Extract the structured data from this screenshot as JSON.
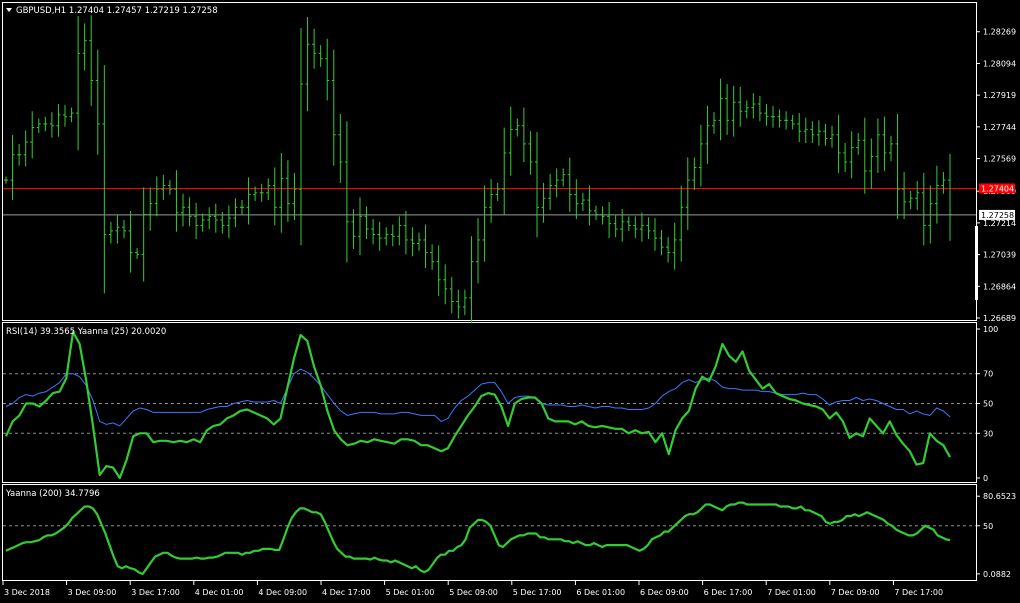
{
  "main_header": {
    "symbol_text": "GBPUSD,H1  1.27404 1.27457 1.27219 1.27258"
  },
  "rsi_header": {
    "text": "RSI(14) 39.3565  Yaanna (25) 20.0020"
  },
  "yaanna_header": {
    "text": "Yaanna (200) 34.7796"
  },
  "price_labels": {
    "red_line": "1.27404",
    "current_price": "1.27258"
  },
  "colors": {
    "background": "#000000",
    "frame": "#ffffff",
    "candles": "#32cd32",
    "rsi_line": "#3c78ff",
    "yaanna_line": "#32cd32",
    "red_line": "#ff0000",
    "grid_dash": "#8c8c8c"
  },
  "chart_data": [
    {
      "type": "ohlc",
      "name": "GBPUSD,H1",
      "y_ticks": [
        "1.28269",
        "1.28094",
        "1.27919",
        "1.27744",
        "1.27569",
        "1.27389",
        "1.27214",
        "1.27039",
        "1.26864",
        "1.26689"
      ],
      "ylim": [
        1.26689,
        1.284
      ],
      "horizontal_lines": [
        1.27404,
        1.27258
      ],
      "close": [
        1.2745,
        1.2759,
        1.2759,
        1.2766,
        1.2774,
        1.2776,
        1.2776,
        1.2775,
        1.2781,
        1.278,
        1.2782,
        1.2815,
        1.2822,
        1.28,
        1.2776,
        1.2715,
        1.2717,
        1.2719,
        1.2717,
        1.2705,
        1.2704,
        1.2726,
        1.2732,
        1.274,
        1.2742,
        1.274,
        1.2727,
        1.273,
        1.2725,
        1.272,
        1.2723,
        1.2725,
        1.2723,
        1.272,
        1.2724,
        1.273,
        1.273,
        1.2737,
        1.2738,
        1.2738,
        1.2742,
        1.273,
        1.2746,
        1.2732,
        1.274,
        1.2798,
        1.282,
        1.2815,
        1.2812,
        1.28,
        1.277,
        1.2755,
        1.2722,
        1.2714,
        1.2725,
        1.2718,
        1.2715,
        1.2713,
        1.2715,
        1.2714,
        1.272,
        1.2712,
        1.271,
        1.2712,
        1.2705,
        1.27,
        1.269,
        1.2685,
        1.2678,
        1.2675,
        1.268,
        1.27,
        1.2712,
        1.273,
        1.2737,
        1.274,
        1.276,
        1.2773,
        1.2775,
        1.2765,
        1.2755,
        1.273,
        1.2735,
        1.2742,
        1.2745,
        1.2748,
        1.2737,
        1.2732,
        1.2734,
        1.2728,
        1.2726,
        1.2725,
        1.2721,
        1.2718,
        1.2722,
        1.272,
        1.2718,
        1.272,
        1.2717,
        1.2713,
        1.2708,
        1.2705,
        1.2712,
        1.273,
        1.2745,
        1.2752,
        1.2765,
        1.2775,
        1.2778,
        1.279,
        1.2778,
        1.2788,
        1.2783,
        1.2785,
        1.2787,
        1.2782,
        1.278,
        1.278,
        1.2778,
        1.2778,
        1.2776,
        1.2772,
        1.2773,
        1.277,
        1.2772,
        1.2768,
        1.277,
        1.276,
        1.2755,
        1.2763,
        1.2767,
        1.275,
        1.2758,
        1.277,
        1.276,
        1.2765,
        1.274,
        1.2733,
        1.2735,
        1.2738,
        1.272,
        1.2732,
        1.2742,
        1.2745,
        1.2726
      ]
    },
    {
      "type": "line",
      "name": "RSI(14) 39.3565  Yaanna (25) 20.0020",
      "y_ticks": [
        "100",
        "70",
        "50",
        "30",
        "0"
      ],
      "ylim": [
        0,
        100
      ],
      "levels": [
        70,
        50,
        30
      ],
      "series": [
        {
          "values": [
            48,
            50,
            54,
            56,
            55,
            57,
            58,
            61,
            64,
            70,
            70,
            68,
            62,
            52,
            38,
            36,
            37,
            35,
            40,
            45,
            47,
            46,
            44,
            44,
            44,
            44,
            44,
            44,
            44,
            44,
            46,
            47,
            48,
            48,
            50,
            51,
            52,
            51,
            51,
            51,
            52,
            50,
            60,
            70,
            73,
            71,
            67,
            62,
            56,
            50,
            45,
            42,
            43,
            44,
            44,
            44,
            43,
            43,
            43,
            44,
            44,
            43,
            42,
            42,
            42,
            38,
            40,
            47,
            52,
            55,
            59,
            63,
            64,
            64,
            58,
            50,
            54,
            55,
            55,
            54,
            50,
            49,
            49,
            49,
            48,
            48,
            49,
            48,
            47,
            48,
            48,
            47,
            47,
            46,
            46,
            46,
            47,
            50,
            55,
            58,
            60,
            64,
            66,
            64,
            66,
            67,
            65,
            61,
            60,
            60,
            59,
            59,
            59,
            58,
            58,
            57,
            56,
            56,
            56,
            57,
            56,
            56,
            53,
            49,
            51,
            52,
            52,
            54,
            52,
            53,
            52,
            50,
            48,
            46,
            46,
            43,
            45,
            43,
            42,
            47,
            45,
            41
          ],
          "color": "#3c78ff"
        },
        {
          "values": [
            28,
            38,
            42,
            50,
            50,
            48,
            52,
            57,
            58,
            67,
            98,
            90,
            65,
            35,
            2,
            8,
            7,
            0,
            12,
            28,
            30,
            30,
            24,
            25,
            25,
            24,
            25,
            24,
            26,
            24,
            32,
            35,
            36,
            40,
            42,
            45,
            46,
            44,
            42,
            40,
            36,
            40,
            60,
            80,
            96,
            92,
            75,
            62,
            45,
            32,
            26,
            22,
            23,
            25,
            24,
            26,
            25,
            24,
            23,
            26,
            26,
            25,
            22,
            22,
            20,
            18,
            20,
            28,
            35,
            42,
            48,
            55,
            57,
            56,
            48,
            35,
            50,
            53,
            54,
            54,
            50,
            40,
            38,
            38,
            38,
            36,
            38,
            35,
            34,
            35,
            34,
            33,
            33,
            30,
            32,
            30,
            31,
            24,
            30,
            16,
            32,
            40,
            45,
            60,
            68,
            65,
            75,
            90,
            82,
            78,
            85,
            72,
            66,
            60,
            63,
            57,
            55,
            53,
            52,
            50,
            49,
            48,
            46,
            40,
            44,
            38,
            27,
            30,
            28,
            40,
            35,
            30,
            38,
            29,
            23,
            18,
            9,
            10,
            30,
            25,
            22,
            14
          ],
          "color": "#32cd32"
        }
      ]
    },
    {
      "type": "line",
      "name": "Yaanna (200) 34.7796",
      "y_ticks": [
        "80.6523",
        "50",
        "0.0882"
      ],
      "ylim": [
        0,
        85
      ],
      "levels": [
        50
      ],
      "series": [
        {
          "values": [
            24,
            26,
            28,
            30,
            32,
            33,
            33,
            34,
            35,
            38,
            40,
            40,
            42,
            45,
            48,
            52,
            58,
            62,
            66,
            70,
            70,
            68,
            62,
            52,
            42,
            30,
            18,
            8,
            6,
            8,
            6,
            5,
            2,
            0,
            6,
            12,
            18,
            20,
            22,
            22,
            19,
            17,
            16,
            16,
            16,
            16,
            17,
            16,
            16,
            17,
            17,
            18,
            20,
            22,
            22,
            22,
            22,
            20,
            22,
            22,
            24,
            24,
            26,
            26,
            26,
            25,
            25,
            36,
            48,
            58,
            64,
            68,
            68,
            66,
            64,
            64,
            62,
            54,
            44,
            34,
            26,
            22,
            18,
            18,
            16,
            16,
            16,
            16,
            15,
            17,
            15,
            14,
            14,
            12,
            14,
            12,
            10,
            8,
            6,
            8,
            4,
            2,
            4,
            10,
            16,
            20,
            20,
            24,
            24,
            28,
            30,
            36,
            48,
            52,
            56,
            56,
            54,
            50,
            40,
            30,
            28,
            32,
            36,
            38,
            40,
            40,
            42,
            42,
            42,
            38,
            38,
            36,
            36,
            36,
            36,
            34,
            34,
            32,
            34,
            32,
            30,
            30,
            32,
            30,
            28,
            30,
            30,
            30,
            30,
            30,
            30,
            28,
            26,
            24,
            26,
            30,
            36,
            38,
            40,
            44,
            44,
            48,
            52,
            56,
            60,
            62,
            62,
            64,
            68,
            72,
            72,
            70,
            68,
            66,
            70,
            72,
            72,
            74,
            74,
            72,
            72,
            72,
            72,
            72,
            72,
            72,
            72,
            70,
            70,
            70,
            68,
            68,
            70,
            66,
            66,
            64,
            62,
            60,
            54,
            52,
            54,
            54,
            56,
            60,
            60,
            62,
            60,
            62,
            64,
            62,
            60,
            58,
            56,
            52,
            50,
            46,
            44,
            42,
            40,
            40,
            42,
            46,
            50,
            48,
            46,
            40,
            38,
            36,
            35
          ],
          "color": "#32cd32"
        }
      ]
    }
  ],
  "x_axis": {
    "labels": [
      "3 Dec 2018",
      "3 Dec 09:00",
      "3 Dec 17:00",
      "4 Dec 01:00",
      "4 Dec 09:00",
      "4 Dec 17:00",
      "5 Dec 01:00",
      "5 Dec 09:00",
      "5 Dec 17:00",
      "6 Dec 01:00",
      "6 Dec 09:00",
      "6 Dec 17:00",
      "7 Dec 01:00",
      "7 Dec 09:00",
      "7 Dec 17:00"
    ]
  }
}
